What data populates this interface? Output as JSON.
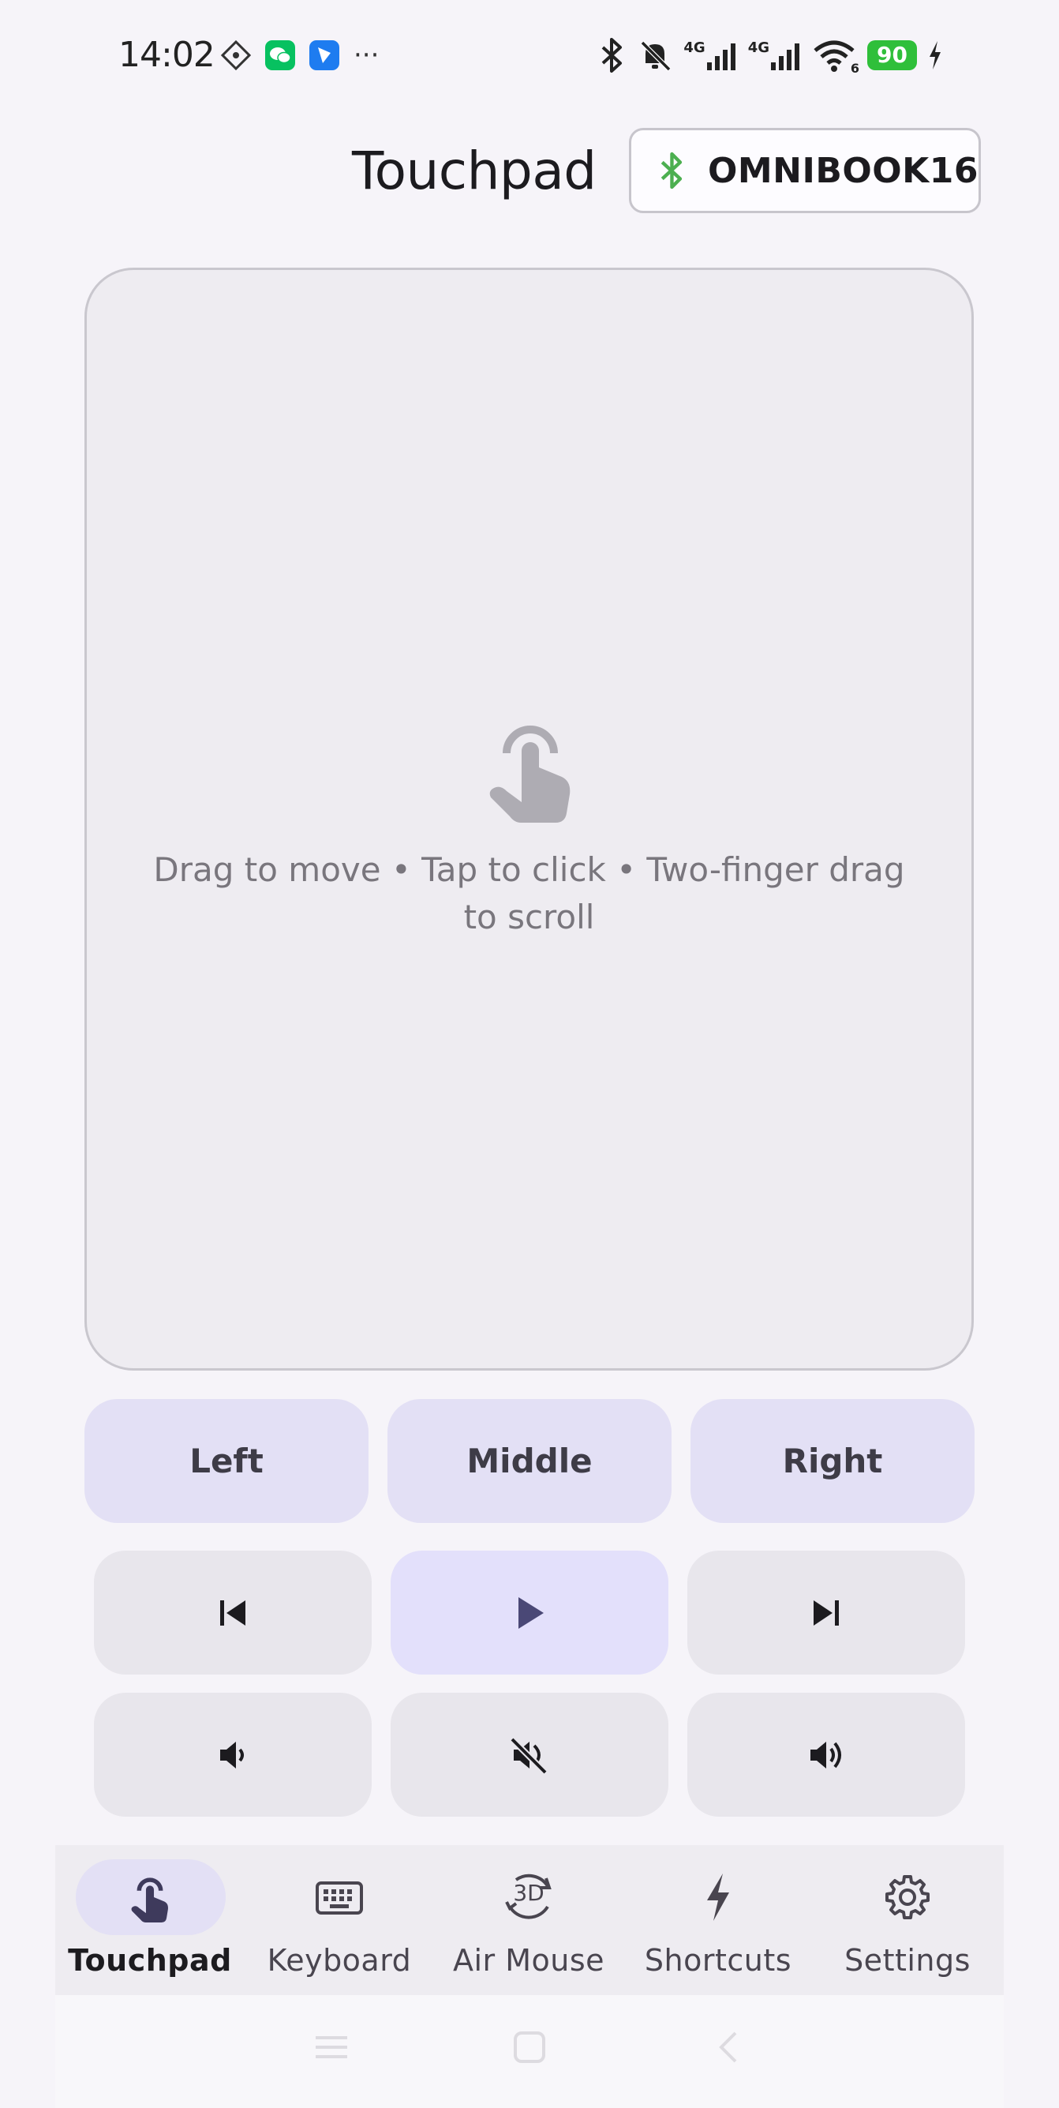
{
  "status_bar": {
    "time": "14:02",
    "left_icons": [
      "wallet-icon",
      "wechat-icon",
      "lark-icon"
    ],
    "overflow": "···",
    "network_labels": [
      "4G",
      "4G"
    ],
    "wifi_sub": "6",
    "battery": "90",
    "colors": {
      "battery": "#2fbf3a",
      "wechat": "#07c160",
      "lark": "#1e7cf0"
    }
  },
  "header": {
    "title": "Touchpad",
    "device_button": {
      "icon": "bluetooth-icon",
      "label": "OMNIBOOK16",
      "icon_color": "#4caf50"
    }
  },
  "touchpad": {
    "icon": "touch-hand-icon",
    "hint": "Drag to move  •  Tap to click  •  Two-finger drag to scroll"
  },
  "mouse_buttons": [
    {
      "label": "Left"
    },
    {
      "label": "Middle"
    },
    {
      "label": "Right"
    }
  ],
  "media_controls": [
    {
      "icon": "skip-previous-icon"
    },
    {
      "icon": "play-icon",
      "active": true
    },
    {
      "icon": "skip-next-icon"
    },
    {
      "icon": "volume-down-icon"
    },
    {
      "icon": "volume-mute-icon"
    },
    {
      "icon": "volume-up-icon"
    }
  ],
  "bottom_nav": {
    "items": [
      {
        "label": "Touchpad",
        "icon": "touch-hand-icon",
        "selected": true
      },
      {
        "label": "Keyboard",
        "icon": "keyboard-icon"
      },
      {
        "label": "Air Mouse",
        "icon": "3d-rotate-icon",
        "icon_text": "3D"
      },
      {
        "label": "Shortcuts",
        "icon": "bolt-icon"
      },
      {
        "label": "Settings",
        "icon": "gear-icon"
      }
    ]
  },
  "accent_color": "#e3e0f5"
}
